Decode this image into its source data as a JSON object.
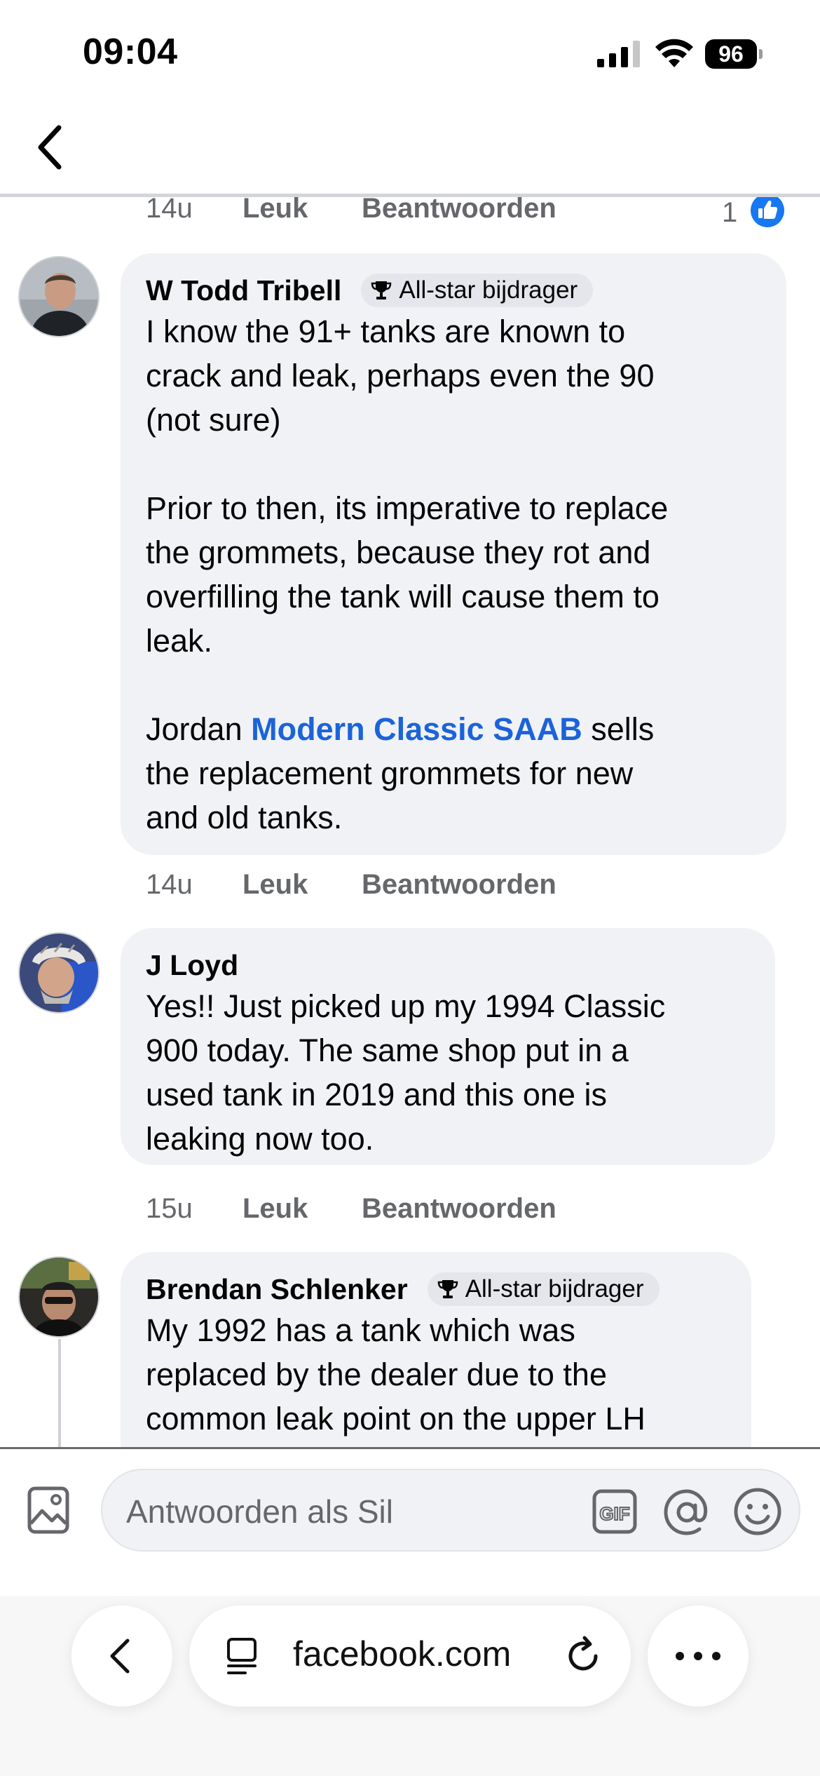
{
  "status": {
    "time": "09:04",
    "battery": "96"
  },
  "top_comment_meta": {
    "time": "14u",
    "like": "Leuk",
    "reply": "Beantwoorden",
    "reactions": "1"
  },
  "comments": [
    {
      "author": "W Todd Tribell",
      "badge": "All-star bijdrager",
      "text_1": "I know the 91+ tanks are known to\ncrack and leak, perhaps even the 90\n(not sure)\n\nPrior to then, its imperative to replace\nthe grommets, because they rot and\noverfilling the tank will cause them to\nleak.\n\nJordan ",
      "link": "Modern Classic SAAB",
      "text_2": " sells\nthe replacement grommets for new\nand old tanks.",
      "time": "14u",
      "like": "Leuk",
      "reply": "Beantwoorden"
    },
    {
      "author": "J Loyd",
      "text": "Yes!! Just picked up my 1994 Classic\n900 today. The same shop put in a\nused tank in 2019 and this one is\nleaking now too.",
      "time": "15u",
      "like": "Leuk",
      "reply": "Beantwoorden"
    },
    {
      "author": "Brendan Schlenker",
      "badge": "All-star bijdrager",
      "text": "My 1992 has a tank which was\nreplaced by the dealer due to the\ncommon leak point on the upper LH"
    }
  ],
  "reply_box": {
    "placeholder": "Antwoorden als Sil",
    "gif_label": "GIF"
  },
  "browser": {
    "url": "facebook.com"
  },
  "colors": {
    "link": "#1b63d9",
    "like_blue": "#1877f2",
    "bubble": "#f0f2f5",
    "meta": "#65676b"
  }
}
